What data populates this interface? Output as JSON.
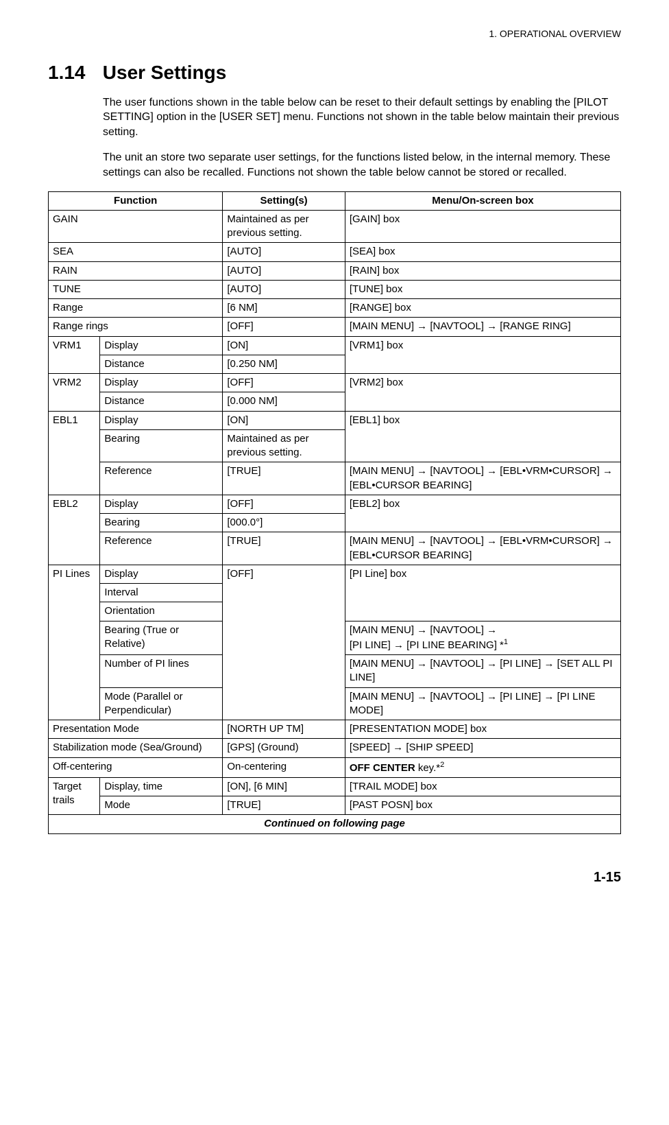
{
  "header": "1.  OPERATIONAL OVERVIEW",
  "section_num": "1.14",
  "section_title": "User Settings",
  "para1": "The user functions shown in the table below can be reset to their default settings by enabling the [PILOT SETTING] option in the [USER SET] menu. Functions not shown in the table below maintain their previous setting.",
  "para2": "The unit an store two separate user settings, for the functions listed below, in the internal memory. These settings can also be recalled. Functions not shown the table below cannot be stored or recalled.",
  "th": {
    "c1": "Function",
    "c2": "Setting(s)",
    "c3": "Menu/On-screen box"
  },
  "rows": {
    "gain": {
      "f": "GAIN",
      "s": "Maintained as per previous setting.",
      "m": "[GAIN] box"
    },
    "sea": {
      "f": "SEA",
      "s": "[AUTO]",
      "m": "[SEA] box"
    },
    "rain": {
      "f": "RAIN",
      "s": "[AUTO]",
      "m": "[RAIN] box"
    },
    "tune": {
      "f": "TUNE",
      "s": "[AUTO]",
      "m": "[TUNE] box"
    },
    "range": {
      "f": "Range",
      "s": "[6 NM]",
      "m": "[RANGE] box"
    },
    "rrings": {
      "f": "Range rings",
      "s": "[OFF]",
      "m": "[MAIN MENU] → [NAVTOOL] → [RANGE RING]"
    },
    "vrm1": {
      "f": "VRM1",
      "sub1": "Display",
      "s1": "[ON]",
      "sub2": "Distance",
      "s2": "[0.250 NM]",
      "m": "[VRM1] box"
    },
    "vrm2": {
      "f": "VRM2",
      "sub1": "Display",
      "s1": "[OFF]",
      "sub2": "Distance",
      "s2": "[0.000 NM]",
      "m": "[VRM2] box"
    },
    "ebl1": {
      "f": "EBL1",
      "sub1": "Display",
      "s1": "[ON]",
      "m1": "[EBL1] box",
      "sub2": "Bearing",
      "s2": "Maintained as per previous setting.",
      "sub3": "Reference",
      "s3": "[TRUE]",
      "m3": "[MAIN MENU] → [NAVTOOL] → [EBL•VRM•CURSOR] → [EBL•CURSOR BEARING]"
    },
    "ebl2": {
      "f": "EBL2",
      "sub1": "Display",
      "s1": "[OFF]",
      "m1": "[EBL2] box",
      "sub2": "Bearing",
      "s2": "[000.0°]",
      "sub3": "Reference",
      "s3": "[TRUE]",
      "m3": "[MAIN MENU] → [NAVTOOL] → [EBL•VRM•CURSOR] → [EBL•CURSOR BEARING]"
    },
    "pilines": {
      "f": "PI Lines",
      "sub1": "Display",
      "sub2": "Interval",
      "sub3": "Orientation",
      "sub4": "Bearing (True or Relative)",
      "sub5": "Number of PI lines",
      "sub6": "Mode (Parallel or Perpendicular)",
      "s": "[OFF]",
      "m1": "[PI Line] box",
      "m4a": "[MAIN MENU] → [NAVTOOL] →",
      "m4b": "[PI LINE] → [PI LINE BEARING] *",
      "m4sup": "1",
      "m5": "[MAIN MENU] → [NAVTOOL] → [PI LINE] → [SET ALL PI LINE]",
      "m6": "[MAIN MENU] → [NAVTOOL] → [PI LINE] → [PI LINE MODE]"
    },
    "pres": {
      "f": "Presentation Mode",
      "s": "[NORTH UP TM]",
      "m": "[PRESENTATION MODE] box"
    },
    "stab": {
      "f": "Stabilization mode (Sea/Ground)",
      "s": "[GPS] (Ground)",
      "m": "[SPEED] → [SHIP SPEED]"
    },
    "offc": {
      "f": "Off-centering",
      "s": "On-centering",
      "m_bold": "OFF CENTER",
      "m_tail": " key.*",
      "m_sup": "2"
    },
    "trails": {
      "f": "Target trails",
      "sub1": "Display, time",
      "s1": "[ON], [6 MIN]",
      "m1": "[TRAIL MODE] box",
      "sub2": "Mode",
      "s2": "[TRUE]",
      "m2": "[PAST POSN] box"
    }
  },
  "continued": "Continued on following page",
  "page_num": "1-15"
}
